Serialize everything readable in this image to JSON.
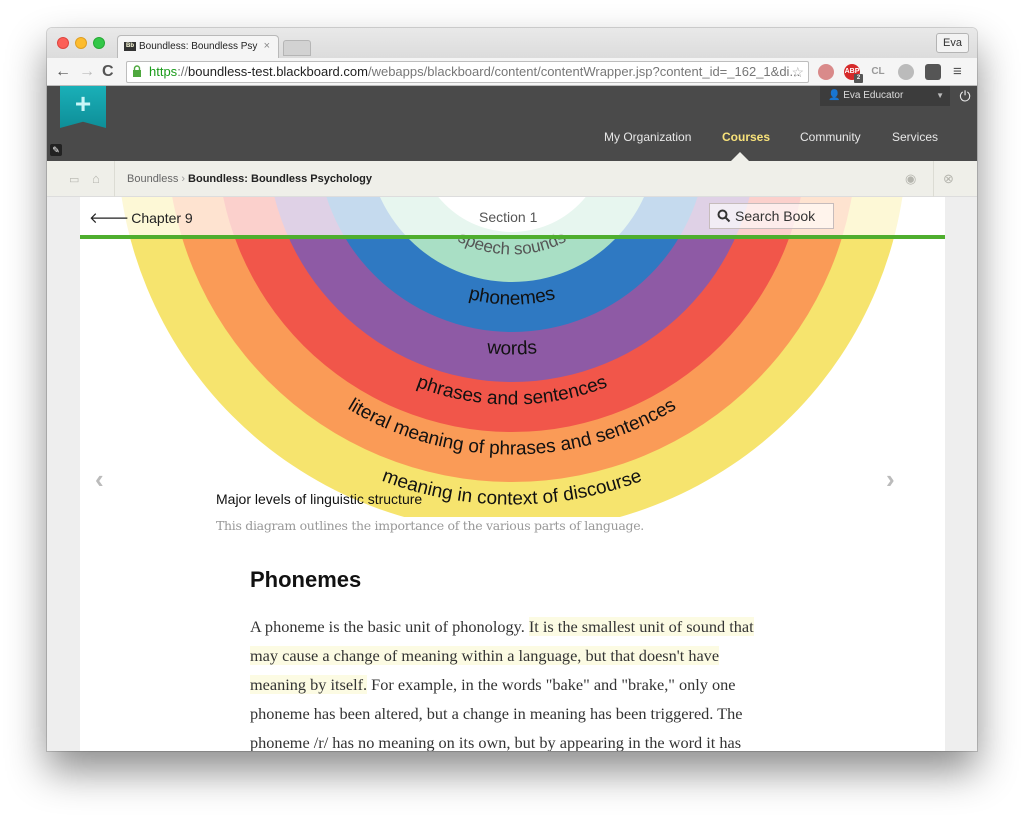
{
  "browser": {
    "tab_title": "Boundless: Boundless Psy",
    "tab_favicon": "bb-icon",
    "profile_label": "Eva",
    "url_scheme": "https",
    "url_host": "boundless-test.blackboard.com",
    "url_path": "/webapps/blackboard/content/contentWrapper.jsp?content_id=_162_1&di...",
    "extensions": [
      "pocket-icon",
      "adblock-icon",
      "cl-icon",
      "ghostery-icon",
      "evernote-icon"
    ],
    "adblock_badge": "2"
  },
  "blackboard": {
    "user_name": "Eva Educator",
    "nav": [
      {
        "label": "My Organization",
        "active": false
      },
      {
        "label": "Courses",
        "active": true
      },
      {
        "label": "Community",
        "active": false
      },
      {
        "label": "Services",
        "active": false
      }
    ],
    "breadcrumb": {
      "root": "Boundless",
      "separator": "›",
      "current": "Boundless: Boundless Psychology"
    }
  },
  "reader": {
    "back_label": "Chapter 9",
    "section_title": "Section 1",
    "search_label": "Search Book",
    "progress_color": "#4fae2e"
  },
  "figure": {
    "rings": [
      {
        "label": "speech sounds",
        "color": "#a9dfc5"
      },
      {
        "label": "phonemes",
        "color": "#2f79c2"
      },
      {
        "label": "words",
        "color": "#8e5aa5"
      },
      {
        "label": "phrases and sentences",
        "color": "#f1564a"
      },
      {
        "label": "literal meaning of phrases and sentences",
        "color": "#fa9b57"
      },
      {
        "label": "meaning in context of discourse",
        "color": "#f6e46e"
      }
    ],
    "title": "Major levels of linguistic structure",
    "caption": "This diagram outlines the importance of the various parts of language.",
    "prev_label": "‹",
    "next_label": "›"
  },
  "article": {
    "heading": "Phonemes",
    "text_before": "A phoneme is the basic unit of phonology. ",
    "text_highlighted": "It is the smallest unit of sound that may cause a change of meaning within a language, but that doesn't have meaning by itself.",
    "text_after": " For example, in the words \"bake\" and \"brake,\" only one phoneme has been altered, but a change in meaning has been triggered. The phoneme /r/ has no meaning on its own, but by appearing in the word it has completely changed the word's meaning!"
  }
}
